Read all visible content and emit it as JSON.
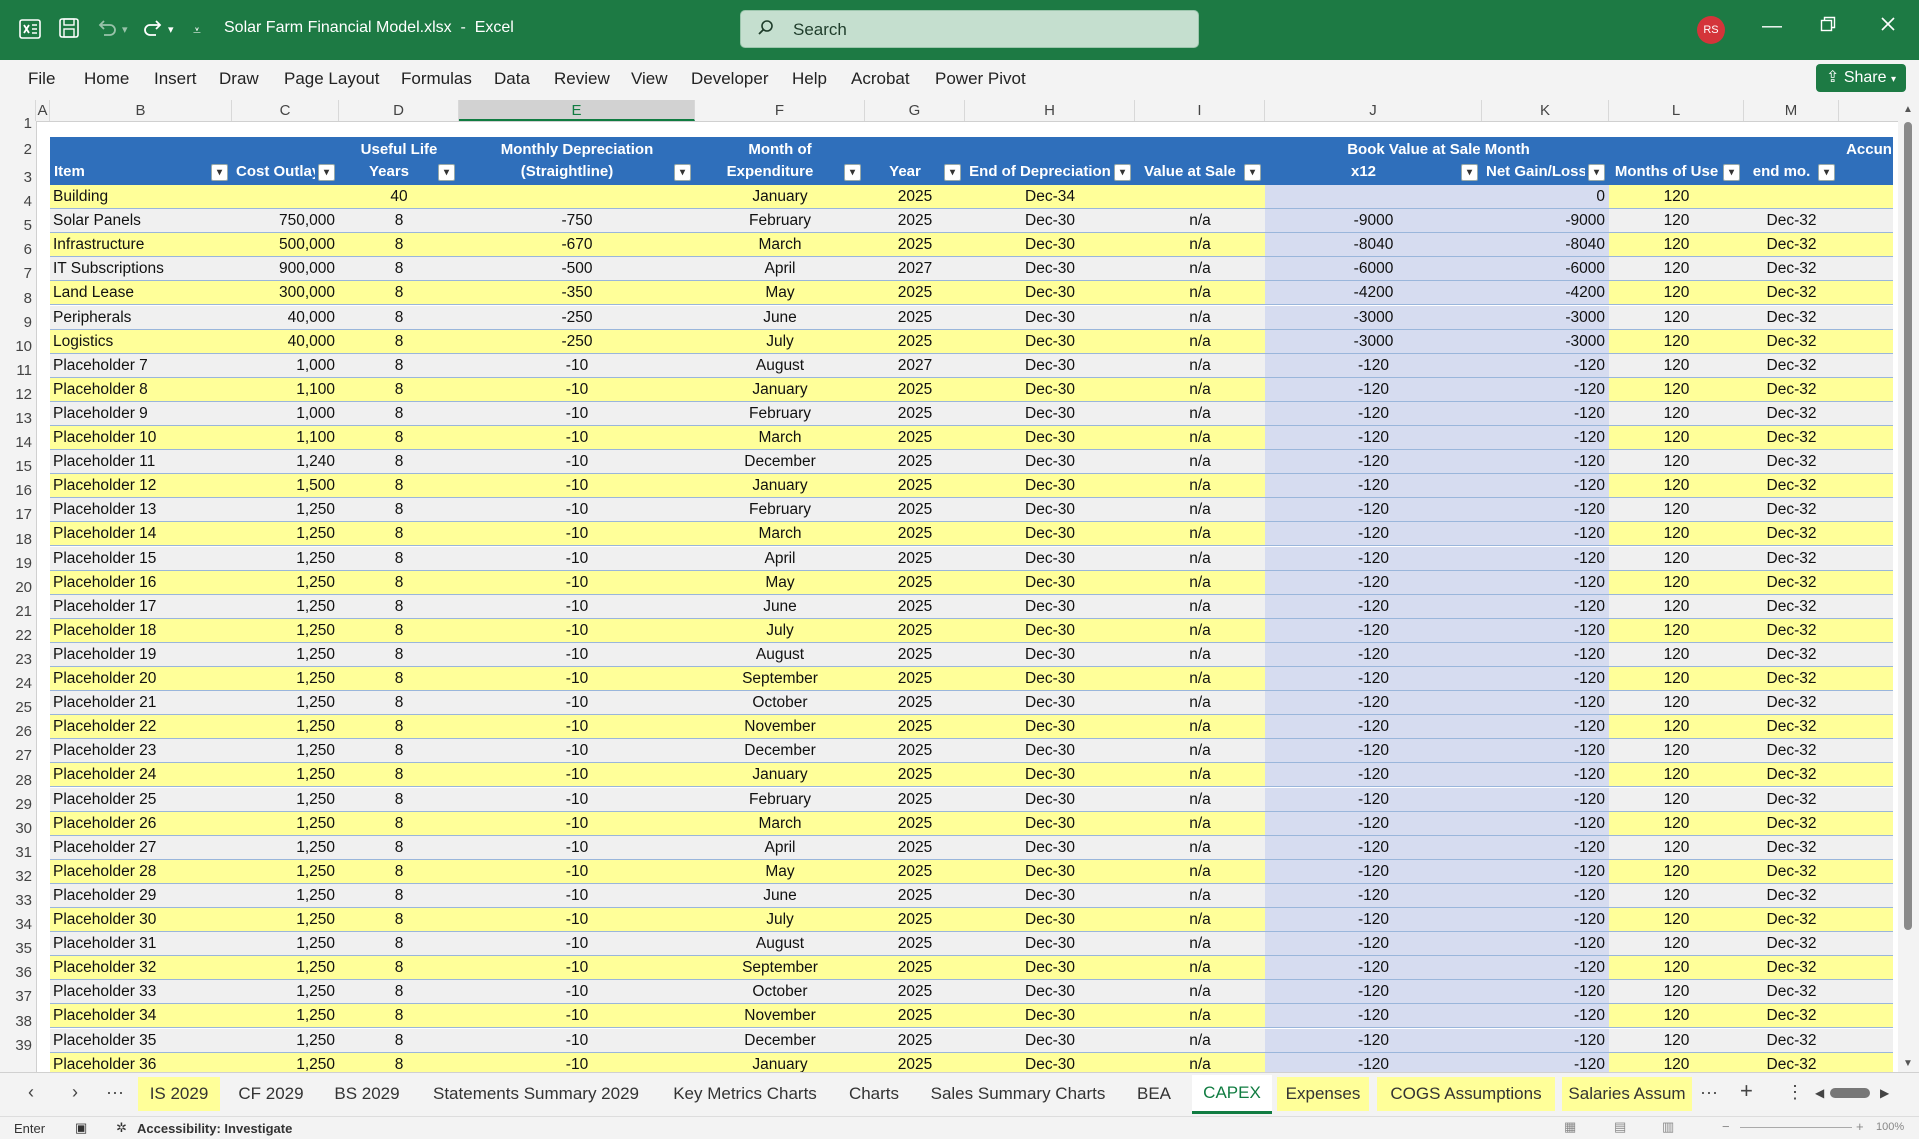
{
  "titlebar": {
    "file_name": "Solar Farm Financial Model.xlsx",
    "separator": "-",
    "app_name": "Excel",
    "search_placeholder": "Search",
    "avatar_initials": "RS"
  },
  "menu": [
    "File",
    "Home",
    "Insert",
    "Draw",
    "Page Layout",
    "Formulas",
    "Data",
    "Review",
    "View",
    "Developer",
    "Help",
    "Acrobat",
    "Power Pivot"
  ],
  "share_label": "Share",
  "column_letters": [
    "A",
    "B",
    "C",
    "D",
    "E",
    "F",
    "G",
    "H",
    "I",
    "J",
    "K",
    "L",
    "M"
  ],
  "selected_column": "E",
  "row_numbers": [
    "1",
    "2",
    "3",
    "4",
    "5",
    "6",
    "7",
    "8",
    "9",
    "10",
    "11",
    "12",
    "13",
    "14",
    "15",
    "16",
    "17",
    "18",
    "19",
    "20",
    "21",
    "22",
    "23",
    "24",
    "25",
    "26",
    "27",
    "28",
    "29",
    "30",
    "31",
    "32",
    "33",
    "34",
    "35",
    "36",
    "37",
    "38",
    "39"
  ],
  "table_headers": [
    {
      "line1": "",
      "line2": "Item"
    },
    {
      "line1": "",
      "line2": "Cost Outlay"
    },
    {
      "line1": "Useful Life",
      "line2": "Years"
    },
    {
      "line1": "Monthly Depreciation",
      "line2": "(Straightline)"
    },
    {
      "line1": "Month of",
      "line2": "Expenditure"
    },
    {
      "line1": "",
      "line2": "Year"
    },
    {
      "line1": "",
      "line2": "End of Depreciation"
    },
    {
      "line1": "",
      "line2": "Value at Sale"
    },
    {
      "line1": "Book Value at Sale Month",
      "line2": "x12"
    },
    {
      "line1": "",
      "line2": "Net Gain/Loss"
    },
    {
      "line1": "",
      "line2": "Months of Use"
    },
    {
      "line1": "",
      "line2": "end mo."
    },
    {
      "line1": "Accun",
      "line2": ""
    }
  ],
  "rows": [
    [
      "Building",
      "",
      "40",
      "",
      "January",
      "2025",
      "Dec-34",
      "",
      "",
      "0",
      "120",
      ""
    ],
    [
      "Solar Panels",
      "750,000",
      "8",
      "-750",
      "February",
      "2025",
      "Dec-30",
      "n/a",
      "-9000",
      "-9000",
      "120",
      "Dec-32"
    ],
    [
      "Infrastructure",
      "500,000",
      "8",
      "-670",
      "March",
      "2025",
      "Dec-30",
      "n/a",
      "-8040",
      "-8040",
      "120",
      "Dec-32"
    ],
    [
      "IT Subscriptions",
      "900,000",
      "8",
      "-500",
      "April",
      "2027",
      "Dec-30",
      "n/a",
      "-6000",
      "-6000",
      "120",
      "Dec-32"
    ],
    [
      "Land Lease",
      "300,000",
      "8",
      "-350",
      "May",
      "2025",
      "Dec-30",
      "n/a",
      "-4200",
      "-4200",
      "120",
      "Dec-32"
    ],
    [
      "Peripherals",
      "40,000",
      "8",
      "-250",
      "June",
      "2025",
      "Dec-30",
      "n/a",
      "-3000",
      "-3000",
      "120",
      "Dec-32"
    ],
    [
      "Logistics",
      "40,000",
      "8",
      "-250",
      "July",
      "2025",
      "Dec-30",
      "n/a",
      "-3000",
      "-3000",
      "120",
      "Dec-32"
    ],
    [
      "Placeholder 7",
      "1,000",
      "8",
      "-10",
      "August",
      "2027",
      "Dec-30",
      "n/a",
      "-120",
      "-120",
      "120",
      "Dec-32"
    ],
    [
      "Placeholder 8",
      "1,100",
      "8",
      "-10",
      "January",
      "2025",
      "Dec-30",
      "n/a",
      "-120",
      "-120",
      "120",
      "Dec-32"
    ],
    [
      "Placeholder 9",
      "1,000",
      "8",
      "-10",
      "February",
      "2025",
      "Dec-30",
      "n/a",
      "-120",
      "-120",
      "120",
      "Dec-32"
    ],
    [
      "Placeholder 10",
      "1,100",
      "8",
      "-10",
      "March",
      "2025",
      "Dec-30",
      "n/a",
      "-120",
      "-120",
      "120",
      "Dec-32"
    ],
    [
      "Placeholder 11",
      "1,240",
      "8",
      "-10",
      "December",
      "2025",
      "Dec-30",
      "n/a",
      "-120",
      "-120",
      "120",
      "Dec-32"
    ],
    [
      "Placeholder 12",
      "1,500",
      "8",
      "-10",
      "January",
      "2025",
      "Dec-30",
      "n/a",
      "-120",
      "-120",
      "120",
      "Dec-32"
    ],
    [
      "Placeholder 13",
      "1,250",
      "8",
      "-10",
      "February",
      "2025",
      "Dec-30",
      "n/a",
      "-120",
      "-120",
      "120",
      "Dec-32"
    ],
    [
      "Placeholder 14",
      "1,250",
      "8",
      "-10",
      "March",
      "2025",
      "Dec-30",
      "n/a",
      "-120",
      "-120",
      "120",
      "Dec-32"
    ],
    [
      "Placeholder 15",
      "1,250",
      "8",
      "-10",
      "April",
      "2025",
      "Dec-30",
      "n/a",
      "-120",
      "-120",
      "120",
      "Dec-32"
    ],
    [
      "Placeholder 16",
      "1,250",
      "8",
      "-10",
      "May",
      "2025",
      "Dec-30",
      "n/a",
      "-120",
      "-120",
      "120",
      "Dec-32"
    ],
    [
      "Placeholder 17",
      "1,250",
      "8",
      "-10",
      "June",
      "2025",
      "Dec-30",
      "n/a",
      "-120",
      "-120",
      "120",
      "Dec-32"
    ],
    [
      "Placeholder 18",
      "1,250",
      "8",
      "-10",
      "July",
      "2025",
      "Dec-30",
      "n/a",
      "-120",
      "-120",
      "120",
      "Dec-32"
    ],
    [
      "Placeholder 19",
      "1,250",
      "8",
      "-10",
      "August",
      "2025",
      "Dec-30",
      "n/a",
      "-120",
      "-120",
      "120",
      "Dec-32"
    ],
    [
      "Placeholder 20",
      "1,250",
      "8",
      "-10",
      "September",
      "2025",
      "Dec-30",
      "n/a",
      "-120",
      "-120",
      "120",
      "Dec-32"
    ],
    [
      "Placeholder 21",
      "1,250",
      "8",
      "-10",
      "October",
      "2025",
      "Dec-30",
      "n/a",
      "-120",
      "-120",
      "120",
      "Dec-32"
    ],
    [
      "Placeholder 22",
      "1,250",
      "8",
      "-10",
      "November",
      "2025",
      "Dec-30",
      "n/a",
      "-120",
      "-120",
      "120",
      "Dec-32"
    ],
    [
      "Placeholder 23",
      "1,250",
      "8",
      "-10",
      "December",
      "2025",
      "Dec-30",
      "n/a",
      "-120",
      "-120",
      "120",
      "Dec-32"
    ],
    [
      "Placeholder 24",
      "1,250",
      "8",
      "-10",
      "January",
      "2025",
      "Dec-30",
      "n/a",
      "-120",
      "-120",
      "120",
      "Dec-32"
    ],
    [
      "Placeholder 25",
      "1,250",
      "8",
      "-10",
      "February",
      "2025",
      "Dec-30",
      "n/a",
      "-120",
      "-120",
      "120",
      "Dec-32"
    ],
    [
      "Placeholder 26",
      "1,250",
      "8",
      "-10",
      "March",
      "2025",
      "Dec-30",
      "n/a",
      "-120",
      "-120",
      "120",
      "Dec-32"
    ],
    [
      "Placeholder 27",
      "1,250",
      "8",
      "-10",
      "April",
      "2025",
      "Dec-30",
      "n/a",
      "-120",
      "-120",
      "120",
      "Dec-32"
    ],
    [
      "Placeholder 28",
      "1,250",
      "8",
      "-10",
      "May",
      "2025",
      "Dec-30",
      "n/a",
      "-120",
      "-120",
      "120",
      "Dec-32"
    ],
    [
      "Placeholder 29",
      "1,250",
      "8",
      "-10",
      "June",
      "2025",
      "Dec-30",
      "n/a",
      "-120",
      "-120",
      "120",
      "Dec-32"
    ],
    [
      "Placeholder 30",
      "1,250",
      "8",
      "-10",
      "July",
      "2025",
      "Dec-30",
      "n/a",
      "-120",
      "-120",
      "120",
      "Dec-32"
    ],
    [
      "Placeholder 31",
      "1,250",
      "8",
      "-10",
      "August",
      "2025",
      "Dec-30",
      "n/a",
      "-120",
      "-120",
      "120",
      "Dec-32"
    ],
    [
      "Placeholder 32",
      "1,250",
      "8",
      "-10",
      "September",
      "2025",
      "Dec-30",
      "n/a",
      "-120",
      "-120",
      "120",
      "Dec-32"
    ],
    [
      "Placeholder 33",
      "1,250",
      "8",
      "-10",
      "October",
      "2025",
      "Dec-30",
      "n/a",
      "-120",
      "-120",
      "120",
      "Dec-32"
    ],
    [
      "Placeholder 34",
      "1,250",
      "8",
      "-10",
      "November",
      "2025",
      "Dec-30",
      "n/a",
      "-120",
      "-120",
      "120",
      "Dec-32"
    ],
    [
      "Placeholder 35",
      "1,250",
      "8",
      "-10",
      "December",
      "2025",
      "Dec-30",
      "n/a",
      "-120",
      "-120",
      "120",
      "Dec-32"
    ],
    [
      "Placeholder 36",
      "1,250",
      "8",
      "-10",
      "January",
      "2025",
      "Dec-30",
      "n/a",
      "-120",
      "-120",
      "120",
      "Dec-32"
    ]
  ],
  "sheet_tabs": [
    {
      "label": "IS 2029",
      "style": "yellow"
    },
    {
      "label": "CF 2029",
      "style": "plain"
    },
    {
      "label": "BS 2029",
      "style": "plain"
    },
    {
      "label": "Statements Summary 2029",
      "style": "plain"
    },
    {
      "label": "Key Metrics Charts",
      "style": "plain"
    },
    {
      "label": "Charts",
      "style": "plain"
    },
    {
      "label": "Sales Summary Charts",
      "style": "plain"
    },
    {
      "label": "BEA",
      "style": "plain"
    },
    {
      "label": "CAPEX",
      "style": "active"
    },
    {
      "label": "Expenses",
      "style": "yellow"
    },
    {
      "label": "COGS Assumptions",
      "style": "yellow"
    },
    {
      "label": "Salaries Assum",
      "style": "yellow"
    }
  ],
  "status": {
    "mode": "Enter",
    "accessibility": "Accessibility: Investigate",
    "zoom": "100%"
  },
  "colors": {
    "title_green": "#1d7a44",
    "header_blue": "#2f6fbb",
    "row_yellow": "#ffff99",
    "row_gray": "#f0f0f0",
    "book_value_blue": "#d6dcf0"
  },
  "icons": [
    "excel-logo-icon",
    "save-icon",
    "undo-icon",
    "redo-icon",
    "customize-qat-icon",
    "search-icon",
    "minimize-icon",
    "restore-icon",
    "close-icon",
    "share-icon",
    "filter-dropdown-icon",
    "sheet-prev-icon",
    "sheet-next-icon",
    "more-sheets-icon",
    "add-sheet-icon",
    "record-macro-icon",
    "accessibility-icon",
    "normal-view-icon",
    "page-layout-view-icon",
    "page-break-view-icon"
  ]
}
